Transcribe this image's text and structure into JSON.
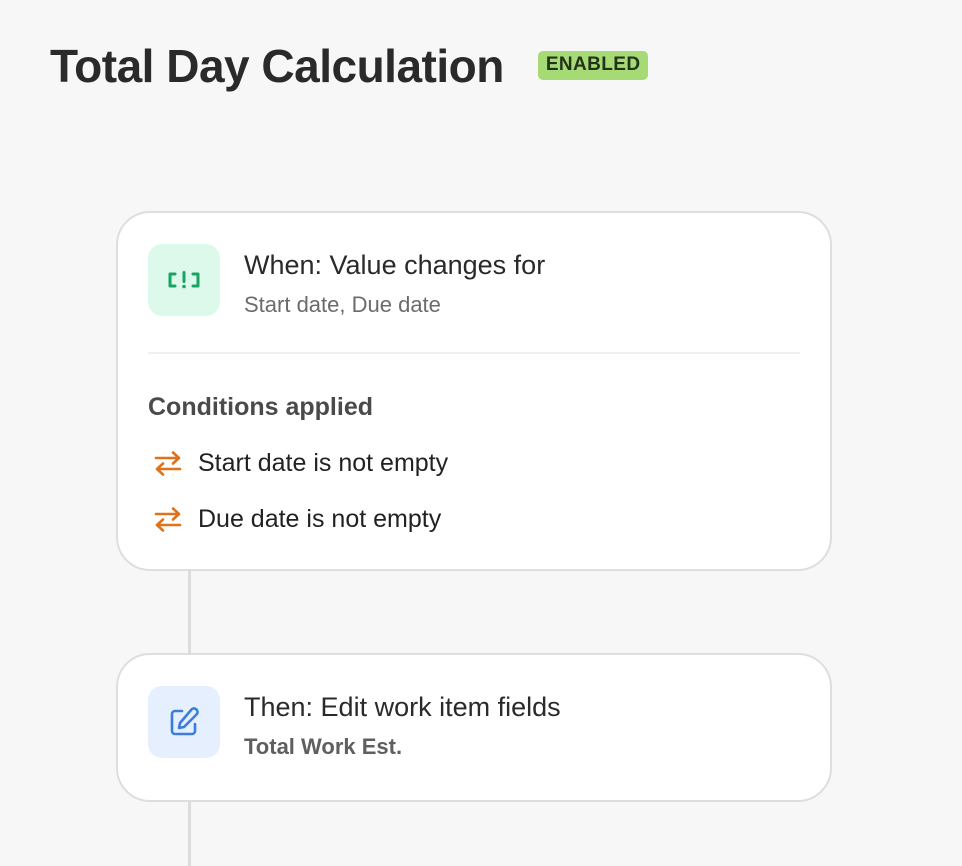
{
  "header": {
    "title": "Total Day Calculation",
    "status": "ENABLED"
  },
  "colors": {
    "status_badge_bg": "#a6da74",
    "trigger_icon": "#19a464",
    "condition_icon": "#e07219",
    "action_icon": "#3b7ddc"
  },
  "trigger": {
    "icon": "trigger-alert-icon",
    "title": "When: Value changes for",
    "fields": "Start date, Due date",
    "conditions_title": "Conditions applied",
    "conditions": [
      {
        "icon": "swap-arrows-icon",
        "label": "Start date is not empty"
      },
      {
        "icon": "swap-arrows-icon",
        "label": "Due date is not empty"
      }
    ]
  },
  "action": {
    "icon": "edit-icon",
    "title": "Then: Edit work item fields",
    "fields": "Total Work Est."
  }
}
